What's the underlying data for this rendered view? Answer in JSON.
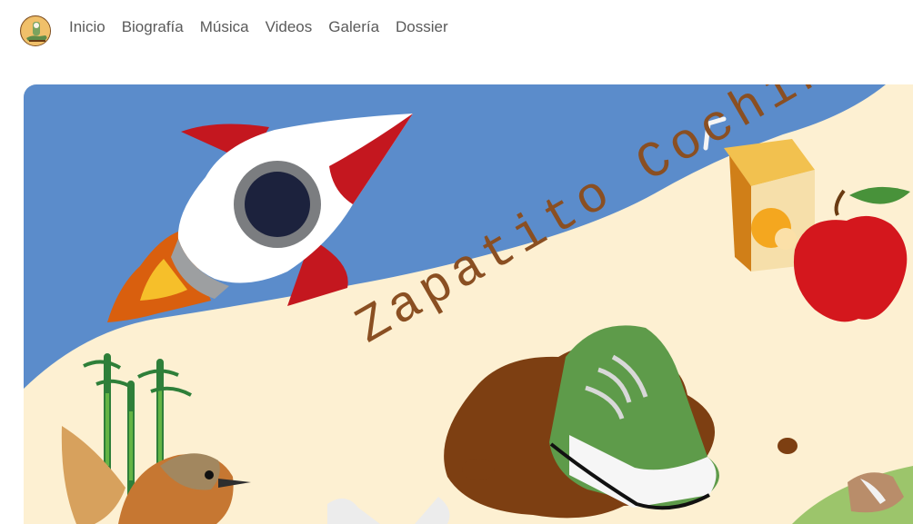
{
  "nav": {
    "logo_icon": "band-logo-icon",
    "items": [
      {
        "label": "Inicio"
      },
      {
        "label": "Biografía"
      },
      {
        "label": "Música"
      },
      {
        "label": "Videos"
      },
      {
        "label": "Galería"
      },
      {
        "label": "Dossier"
      }
    ]
  },
  "hero": {
    "title": "Zapatito Cochinito",
    "colors": {
      "sky": "#5b8ccb",
      "sand": "#fdf0d2",
      "title": "#8a4f22",
      "mud": "#7d3f12",
      "grass": "#9cc56b"
    },
    "illustrations": [
      "rocket-illustration",
      "juice-box-illustration",
      "apple-illustration",
      "bamboo-illustration",
      "bird-illustration",
      "sneaker-illustration",
      "fox-illustration",
      "skull-illustration"
    ]
  }
}
